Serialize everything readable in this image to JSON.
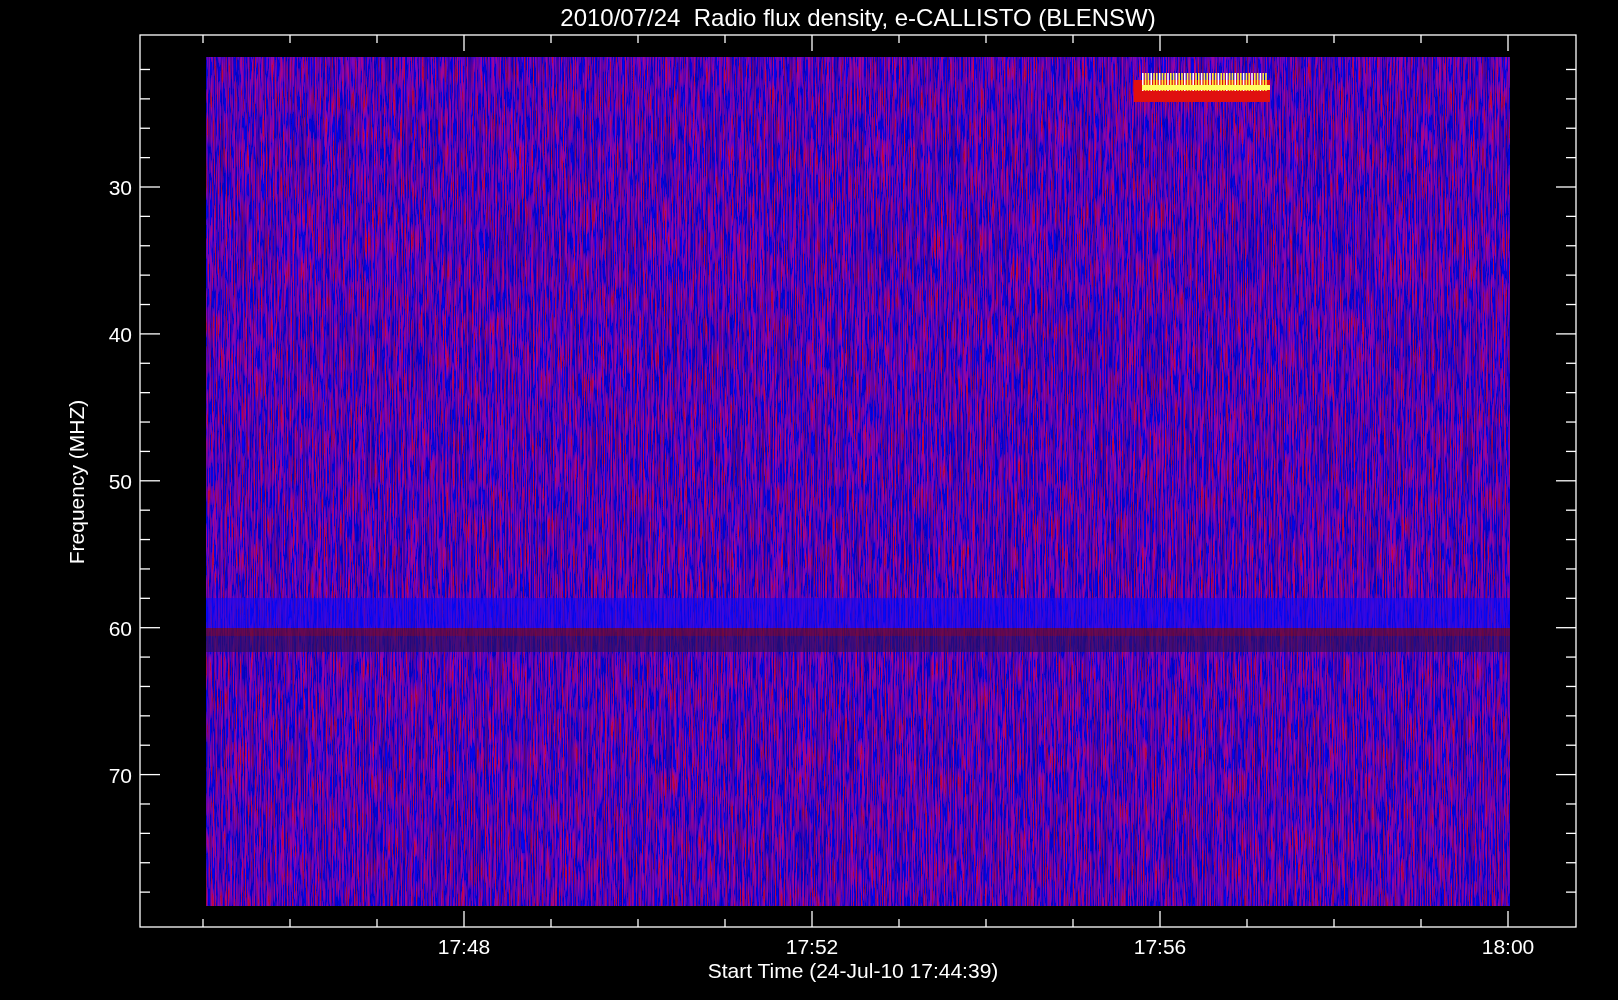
{
  "plot": {
    "title": "2010/07/24  Radio flux density, e-CALLISTO (BLENSW)",
    "xlabel": "Start Time (24-Jul-10 17:44:39)",
    "ylabel": "Frequency (MHZ)",
    "x_tick_labels": [
      "17:48",
      "17:52",
      "17:56",
      "18:00"
    ],
    "y_tick_labels": [
      "30",
      "40",
      "50",
      "60",
      "70"
    ]
  }
}
